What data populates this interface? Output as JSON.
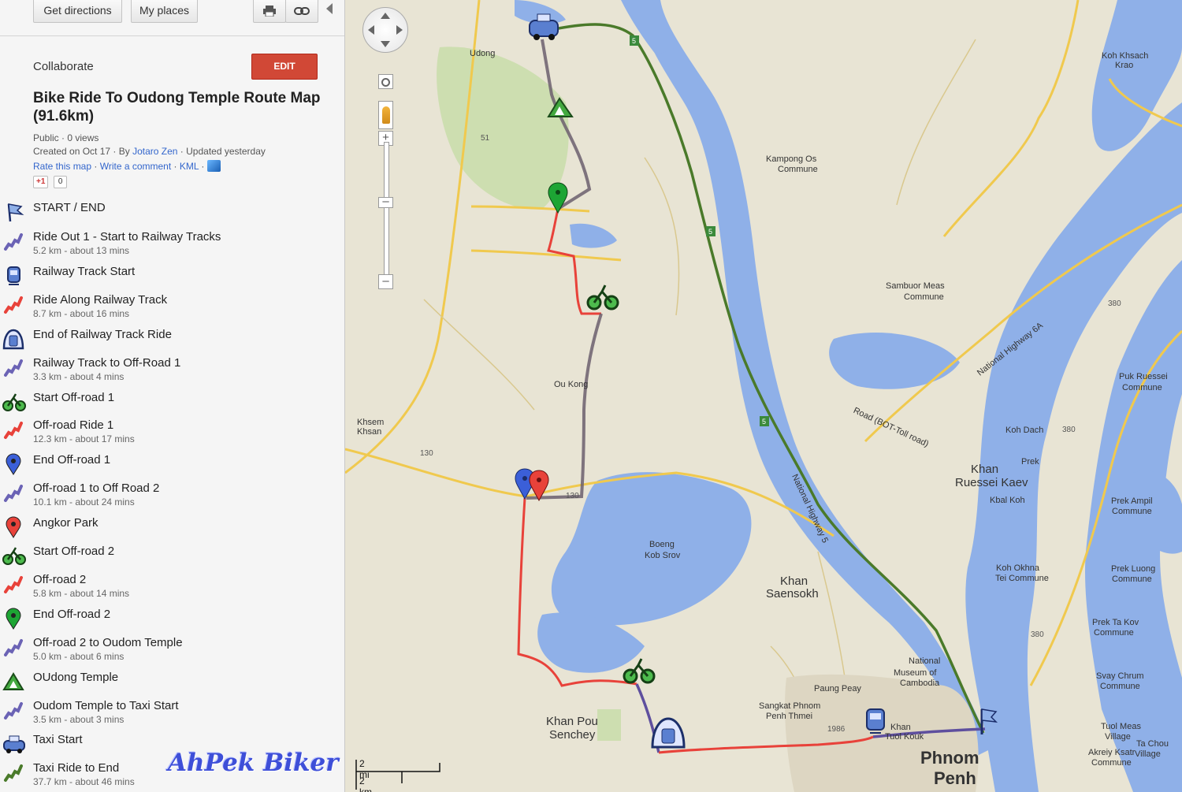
{
  "toolbar": {
    "get_directions": "Get directions",
    "my_places": "My places",
    "print_icon": "print-icon",
    "link_icon": "link-icon",
    "collapse_icon": "collapse-left-icon"
  },
  "map_info": {
    "collaborate": "Collaborate",
    "edit_label": "EDIT",
    "title": "Bike Ride To Oudong Temple Route Map (91.6km)",
    "visibility": "Public",
    "views": "0 views",
    "created": "Created on Oct 17",
    "by_label": "By",
    "author": "Jotaro Zen",
    "updated": "Updated yesterday",
    "links": [
      "Rate this map",
      "Write a comment",
      "KML"
    ],
    "gplus_label": "+1",
    "gplus_count": "0"
  },
  "legend": [
    {
      "icon": "flag-icon",
      "label": "START / END",
      "sub": ""
    },
    {
      "icon": "route-line-purple-icon",
      "label": "Ride Out 1 - Start to Railway Tracks",
      "sub": "5.2 km - about 13 mins"
    },
    {
      "icon": "train-icon",
      "label": "Railway Track Start",
      "sub": ""
    },
    {
      "icon": "route-line-red-icon",
      "label": "Ride Along Railway Track",
      "sub": "8.7 km - about 16 mins"
    },
    {
      "icon": "tunnel-train-icon",
      "label": "End of Railway Track Ride",
      "sub": ""
    },
    {
      "icon": "route-line-purple-icon",
      "label": "Railway Track to Off-Road 1",
      "sub": "3.3 km - about 4 mins"
    },
    {
      "icon": "cyclist-icon",
      "label": "Start Off-road 1",
      "sub": ""
    },
    {
      "icon": "route-line-red-icon",
      "label": "Off-road Ride 1",
      "sub": "12.3 km - about 17 mins"
    },
    {
      "icon": "blue-pin-icon",
      "label": "End Off-road 1",
      "sub": ""
    },
    {
      "icon": "route-line-purple-icon",
      "label": "Off-road 1 to Off Road 2",
      "sub": "10.1 km - about 24 mins"
    },
    {
      "icon": "red-pin-icon",
      "label": "Angkor Park",
      "sub": ""
    },
    {
      "icon": "cyclist-icon",
      "label": "Start Off-road 2",
      "sub": ""
    },
    {
      "icon": "route-line-red-icon",
      "label": "Off-road 2",
      "sub": "5.8 km - about 14 mins"
    },
    {
      "icon": "green-pin-icon",
      "label": "End Off-road 2",
      "sub": ""
    },
    {
      "icon": "route-line-purple-icon",
      "label": "Off-road 2 to Oudom Temple",
      "sub": "5.0 km - about 6 mins"
    },
    {
      "icon": "temple-triangle-icon",
      "label": "OUdong Temple",
      "sub": ""
    },
    {
      "icon": "route-line-purple-icon",
      "label": "Oudom Temple to Taxi Start",
      "sub": "3.5 km - about 3 mins"
    },
    {
      "icon": "taxi-icon",
      "label": "Taxi Start",
      "sub": ""
    },
    {
      "icon": "route-line-green-icon",
      "label": "Taxi Ride to End",
      "sub": "37.7 km - about 46 mins"
    }
  ],
  "watermark": "AhPek Biker",
  "map": {
    "labels": [
      "Udong",
      "Kampong Os",
      "Commune",
      "Sambuor Meas",
      "Commune",
      "Ou Kong",
      "Khsem",
      "Khsan",
      "Boeng",
      "Kob Srov",
      "Khan",
      "Saensokh",
      "Khan Pou",
      "Senchey",
      "National",
      "Museum of",
      "Cambodia",
      "Khan",
      "Ruessei Kaev",
      "Kbal Koh",
      "Koh Dach",
      "Prek",
      "Puk Ruessei",
      "Commune",
      "Prek Ampil",
      "Commune",
      "Prek Luong",
      "Commune",
      "Koh Okhna",
      "Tei Commune",
      "Prek Ta Kov",
      "Commune",
      "Svay Chrum",
      "Commune",
      "Tuol Meas",
      "Village",
      "Akreiy Ksatr",
      "Commune",
      "Ta Chou",
      "Village",
      "Phnom",
      "Penh",
      "Koh Khsach",
      "Krao",
      "National Highway 6A",
      "Road (BOT-Toll road)",
      "National Highway 5",
      "Sangkat Phnom",
      "Penh Thmei",
      "Paung Peay",
      "Khan",
      "Tuol Kouk"
    ],
    "road_numbers": [
      "5",
      "5",
      "5",
      "51",
      "130",
      "130",
      "380",
      "380",
      "380",
      "1986"
    ],
    "scale": [
      "2 mi",
      "2 km"
    ]
  },
  "colors": {
    "edit_button": "#d14836",
    "route_red": "#e8423a",
    "route_purple": "#5e4f9e",
    "route_grey": "#6b5f6d",
    "route_green": "#4a7a2a",
    "water": "#8fb0e8",
    "land": "#e8e4d4"
  }
}
